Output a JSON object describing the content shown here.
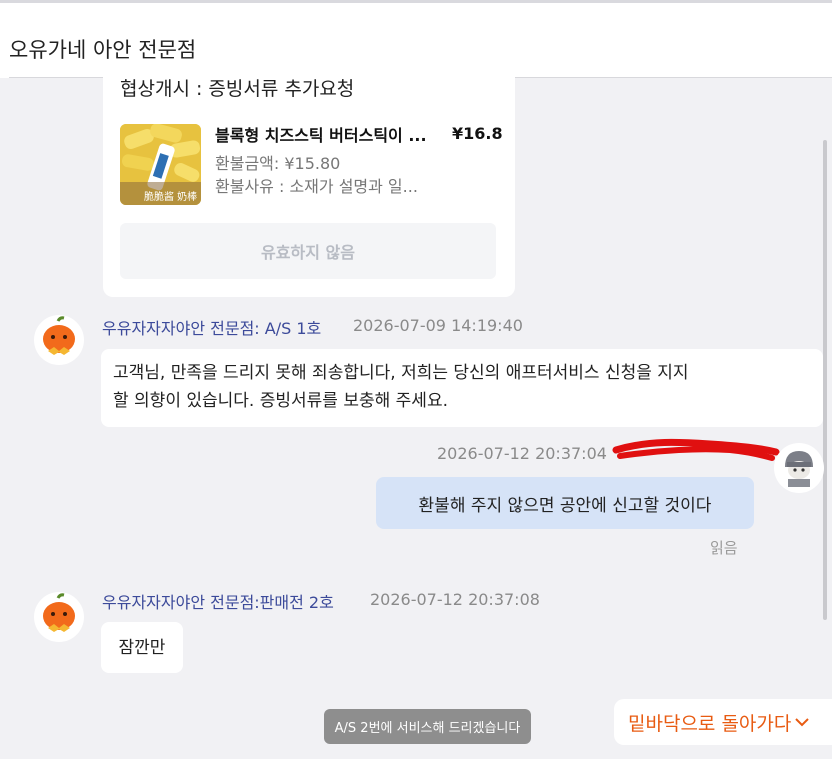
{
  "header": {
    "title": "오유가네 아안 전문점"
  },
  "card": {
    "negotiation": "협상개시 : 증빙서류 추가요청",
    "product_name": "블록형 치즈스틱 버터스틱이 ...",
    "price": "¥16.8",
    "refund_amount": "환불금액: ¥15.80",
    "refund_reason": "환불사유 : 소재가 설명과 일...",
    "invalid_label": "유효하지 않음",
    "thumb_caption": "脆脆酱 奶棒"
  },
  "messages": [
    {
      "sender": "우유자자자야안 전문점: A/S 1호",
      "time": "2026-07-09 14:19:40",
      "lines": [
        "고객님, 만족을 드리지 못해 죄송합니다, 저희는 당신의 애프터서비스 신청을 지지",
        "할 의향이 있습니다. 증빙서류를 보충해 주세요."
      ]
    },
    {
      "time": "2026-07-12 20:37:04",
      "text": "환불해 주지 않으면 공안에 신고할 것이다",
      "read_status": "읽음"
    },
    {
      "sender": "우유자자자야안 전문점:판매전 2호",
      "time": "2026-07-12 20:37:08",
      "text": "잠깐만"
    }
  ],
  "toast": "A/S 2번에 서비스해 드리겠습니다",
  "scroll_bottom_button": "밑바닥으로 돌아가다",
  "icons": {
    "shop_avatar": "pumpkin-mascot-icon",
    "user_avatar": "gray-character-icon",
    "chevron": "chevron-down-icon"
  },
  "colors": {
    "accent": "#e85b12",
    "sender_name": "#3c4a9a",
    "my_bubble": "#d6e3f7",
    "redaction": "#e01010"
  }
}
